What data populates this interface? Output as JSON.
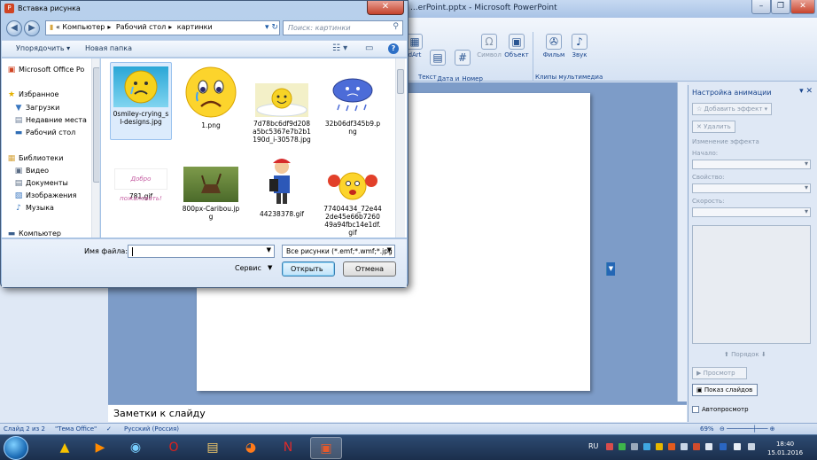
{
  "ppt": {
    "title": "...erPoint.pptx - Microsoft PowerPoint",
    "ribbon": {
      "buttons": [
        {
          "label": "dArt"
        },
        {
          "label": "Дата и\nвремя"
        },
        {
          "label": "Номер\nслайда"
        },
        {
          "label": "Символ"
        },
        {
          "label": "Объект"
        },
        {
          "label": "Фильм"
        },
        {
          "label": "Звук"
        }
      ],
      "group_text": "Текст",
      "group_media": "Клипы мультимедиа"
    },
    "notes_placeholder": "Заметки к слайду",
    "anim_pane": {
      "title": "Настройка анимации",
      "add_effect": "Добавить эффект",
      "remove": "Удалить",
      "change_effect": "Изменение эффекта",
      "start_label": "Начало:",
      "property_label": "Свойство:",
      "speed_label": "Скорость:",
      "order_label": "Порядок",
      "preview": "Просмотр",
      "slideshow": "Показ слайдов",
      "autopreview": "Автопросмотр"
    },
    "status": {
      "slide": "Слайд 2 из 2",
      "theme": "\"Тема Office\"",
      "language": "Русский (Россия)",
      "zoom": "69%"
    }
  },
  "taskbar": {
    "lang": "RU",
    "time": "18:40",
    "date": "15.01.2016"
  },
  "dialog": {
    "title": "Вставка рисунка",
    "address": {
      "prefix": "«",
      "segments": [
        "Компьютер",
        "Рабочий стол",
        "картинки"
      ]
    },
    "search_placeholder": "Поиск: картинки",
    "organize": "Упорядочить",
    "new_folder": "Новая папка",
    "nav": {
      "top_item": "Microsoft Office Po",
      "favorites": "Избранное",
      "downloads": "Загрузки",
      "recent": "Недавние места",
      "desktop": "Рабочий стол",
      "libraries": "Библиотеки",
      "video": "Видео",
      "documents": "Документы",
      "images": "Изображения",
      "music": "Музыка",
      "computer": "Компьютер"
    },
    "files": [
      {
        "name": "0smiley-crying_sl-designs.jpg"
      },
      {
        "name": "1.png"
      },
      {
        "name": "7d78bc6df9d208a5bc5367e7b2b1190d_i-30578.jpg"
      },
      {
        "name": "32b06df345b9.png"
      },
      {
        "name": "781.gif",
        "thumb_text": "Добро пожаловать!"
      },
      {
        "name": "800px-Caribou.jpg"
      },
      {
        "name": "44238378.gif"
      },
      {
        "name": "77404434_72e442de45e66b726049a94fbc14e1df.gif"
      }
    ],
    "filename_label": "Имя файла:",
    "filename_value": "",
    "filter": "Все рисунки (*.emf;*.wmf;*.jpg",
    "service": "Сервис",
    "open": "Открыть",
    "cancel": "Отмена"
  }
}
